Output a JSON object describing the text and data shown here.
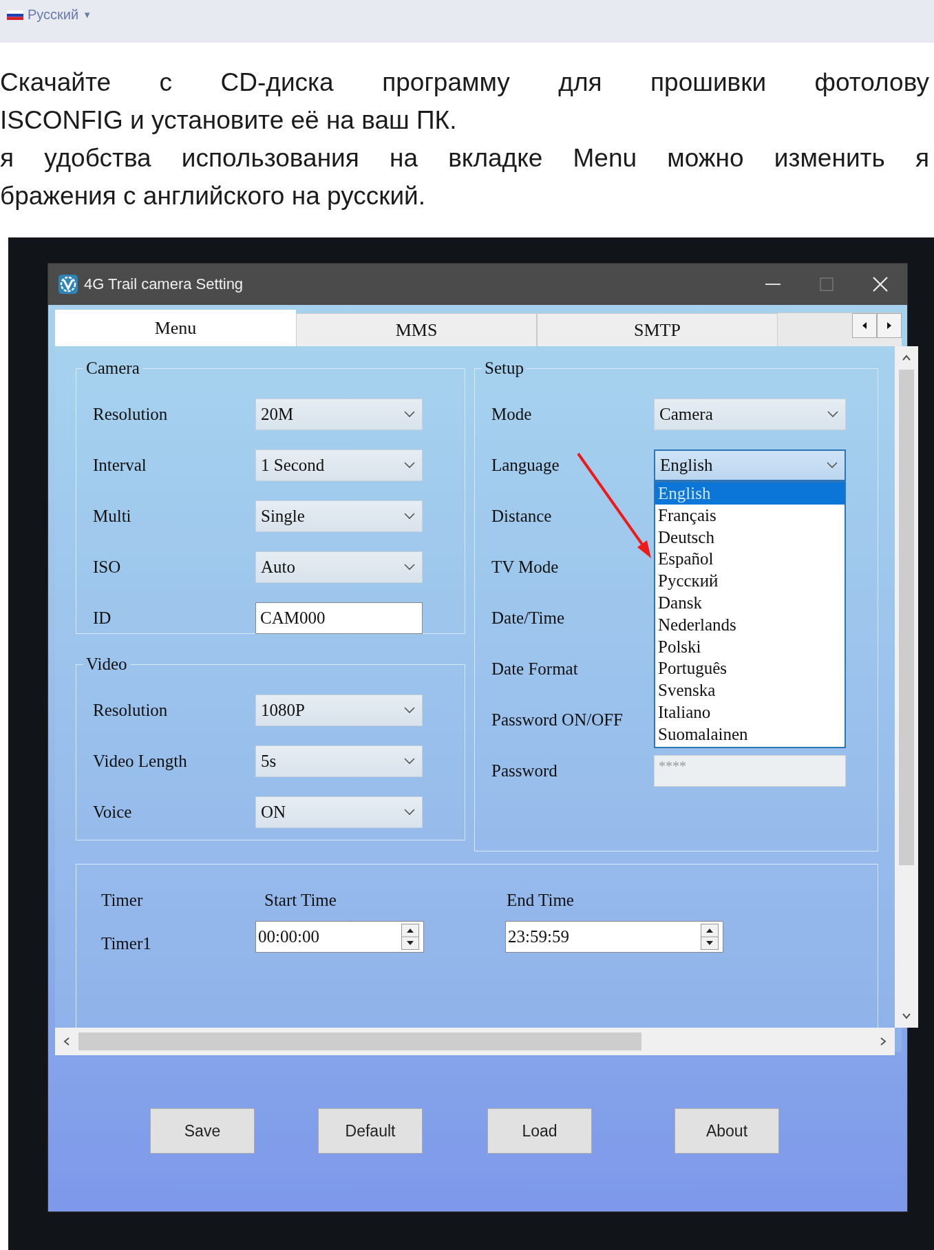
{
  "site_header": {
    "language": "Русский",
    "caret": "▼"
  },
  "article": {
    "paragraphs": [
      {
        "lines": [
          "Скачайте с CD-диска программу для прошивки фотолову",
          "ISCONFIG и установите её на ваш ПК."
        ]
      },
      {
        "lines": [
          "я удобства использования на вкладке Menu можно изменить я",
          "бражения с английского на русский."
        ]
      }
    ]
  },
  "app_window": {
    "title": "4G Trail camera Setting",
    "tabs": [
      {
        "label": "Menu",
        "selected": true
      },
      {
        "label": "MMS",
        "selected": false
      },
      {
        "label": "SMTP",
        "selected": false
      }
    ],
    "camera": {
      "title": "Camera",
      "fields": [
        {
          "label": "Resolution",
          "kind": "dropdown",
          "value": "20M"
        },
        {
          "label": "Interval",
          "kind": "dropdown",
          "value": "1 Second"
        },
        {
          "label": "Multi",
          "kind": "dropdown",
          "value": "Single"
        },
        {
          "label": "ISO",
          "kind": "dropdown",
          "value": "Auto"
        },
        {
          "label": "ID",
          "kind": "text",
          "value": "CAM000"
        }
      ]
    },
    "video": {
      "title": "Video",
      "fields": [
        {
          "label": "Resolution",
          "kind": "dropdown",
          "value": "1080P"
        },
        {
          "label": "Video Length",
          "kind": "dropdown",
          "value": "5s"
        },
        {
          "label": "Voice",
          "kind": "dropdown",
          "value": "ON"
        }
      ]
    },
    "setup": {
      "title": "Setup",
      "fields": [
        {
          "label": "Mode",
          "kind": "dropdown",
          "value": "Camera"
        },
        {
          "label": "Language",
          "kind": "dropdown",
          "value": "English",
          "expanded": true
        },
        {
          "label": "Distance",
          "kind": "label"
        },
        {
          "label": "TV Mode",
          "kind": "label"
        },
        {
          "label": "Date/Time",
          "kind": "label"
        },
        {
          "label": "Date Format",
          "kind": "label"
        },
        {
          "label": "Password ON/OFF",
          "kind": "label"
        },
        {
          "label": "Password",
          "kind": "password",
          "placeholder": "****"
        }
      ]
    },
    "language_options": [
      {
        "label": "English",
        "selected": true
      },
      {
        "label": "Français",
        "selected": false
      },
      {
        "label": "Deutsch",
        "selected": false
      },
      {
        "label": "Español",
        "selected": false
      },
      {
        "label": "Русский",
        "selected": false
      },
      {
        "label": "Dansk",
        "selected": false
      },
      {
        "label": "Nederlands",
        "selected": false
      },
      {
        "label": "Polski",
        "selected": false
      },
      {
        "label": "Português",
        "selected": false
      },
      {
        "label": "Svenska",
        "selected": false
      },
      {
        "label": "Italiano",
        "selected": false
      },
      {
        "label": "Suomalainen",
        "selected": false
      }
    ],
    "timer": {
      "title": "Timer",
      "start_heading": "Start Time",
      "end_heading": "End Time",
      "rows": [
        {
          "label": "Timer1",
          "start": "00:00:00",
          "end": "23:59:59"
        }
      ]
    },
    "buttons": [
      "Save",
      "Default",
      "Load",
      "About"
    ]
  }
}
